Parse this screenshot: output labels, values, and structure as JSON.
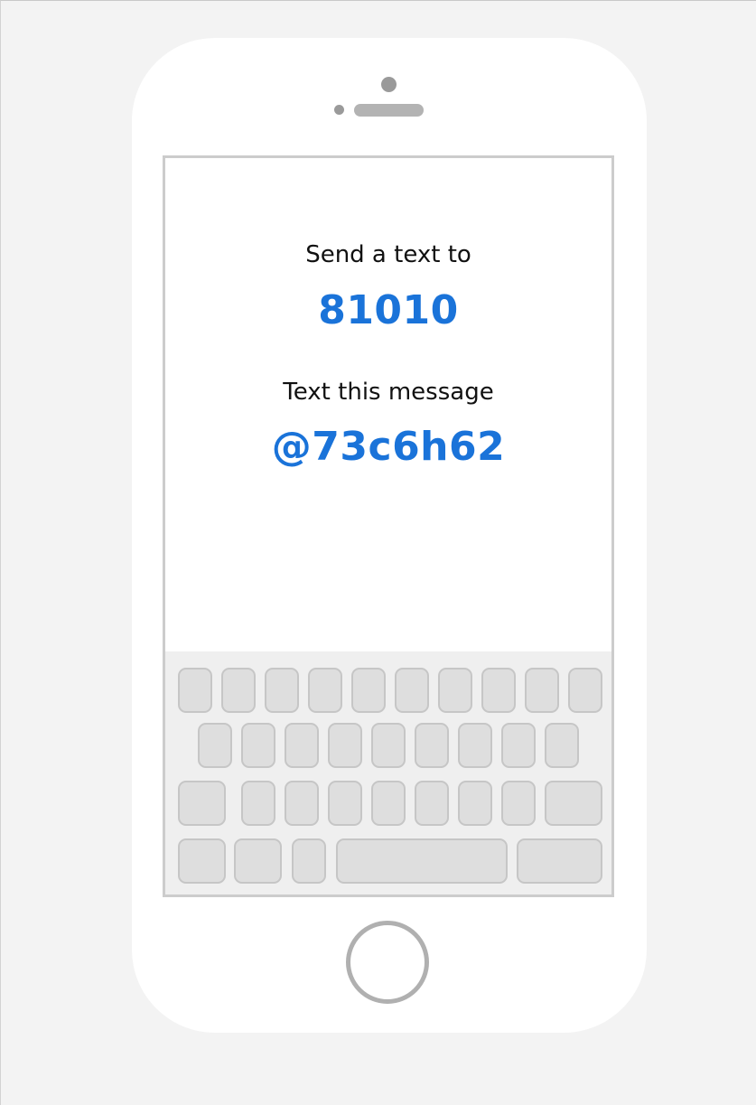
{
  "message": {
    "send_label": "Send a text to",
    "number": "81010",
    "message_label": "Text this message",
    "code": "@73c6h62"
  },
  "colors": {
    "accent": "#1a73d9",
    "text": "#111111",
    "device": "#ffffff",
    "background": "#f3f3f3",
    "key": "#dedede",
    "key_border": "#c6c6c6"
  },
  "icons": {
    "home_button": "home-button-icon",
    "camera": "camera-icon",
    "speaker": "speaker-icon"
  }
}
